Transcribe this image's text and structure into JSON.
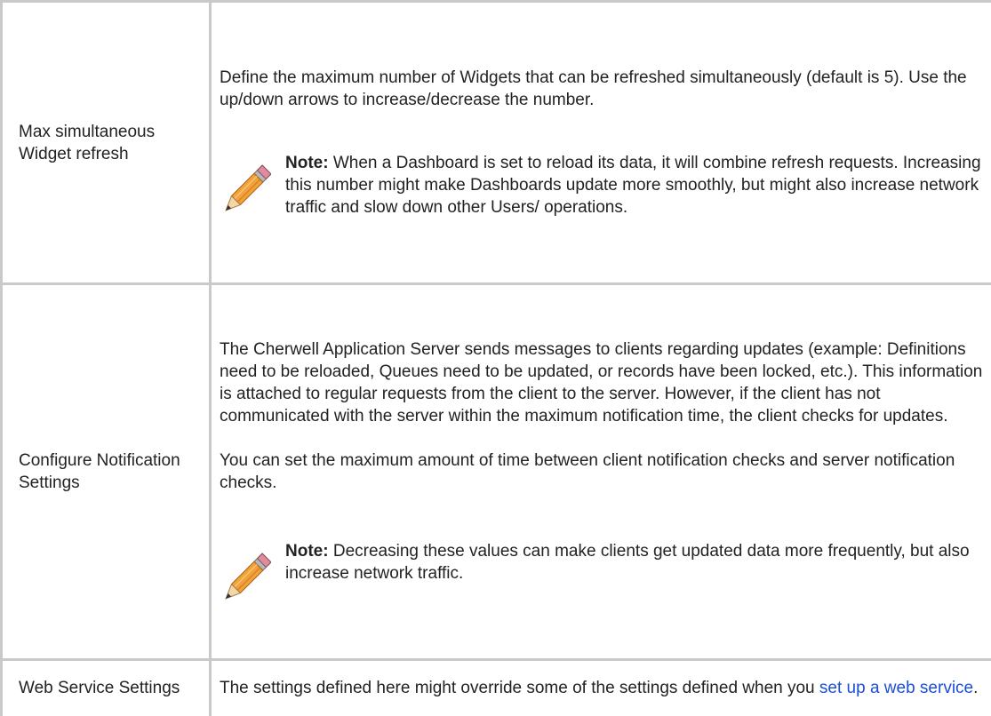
{
  "rows": [
    {
      "label": "Max simultaneous Widget refresh",
      "paragraphs": [
        "Define the maximum number of Widgets that can be refreshed simultaneously (default is 5). Use the up/down arrows to increase/decrease the number."
      ],
      "note": {
        "title": "Note:",
        "text": "When a Dashboard is set to reload its data, it will combine refresh requests. Increasing this number might make Dashboards update more smoothly, but might also increase network traffic and slow down other Users/ operations."
      }
    },
    {
      "label": "Configure Notification Settings",
      "paragraphs": [
        "The Cherwell Application Server sends messages to clients regarding updates (example: Definitions need to be reloaded, Queues need to be updated, or records have been locked, etc.). This information is attached to regular requests from the client to the server. However, if the client has not communicated with the server within the maximum notification time, the client checks for updates.",
        "You can set the maximum amount of time between client notification checks and server notification checks."
      ],
      "note": {
        "title": "Note:",
        "text": "Decreasing these values can make clients get updated data more frequently, but also increase network traffic."
      }
    },
    {
      "label": "Web Service Settings",
      "text_before_link": "The settings defined here might override some of the settings defined when you ",
      "link_text": "set up a web service",
      "text_after_link": "."
    }
  ],
  "icons": {
    "note": "pencil-icon"
  },
  "colors": {
    "border": "#c9c9c9",
    "link": "#1a4fd6",
    "text": "#222222"
  }
}
